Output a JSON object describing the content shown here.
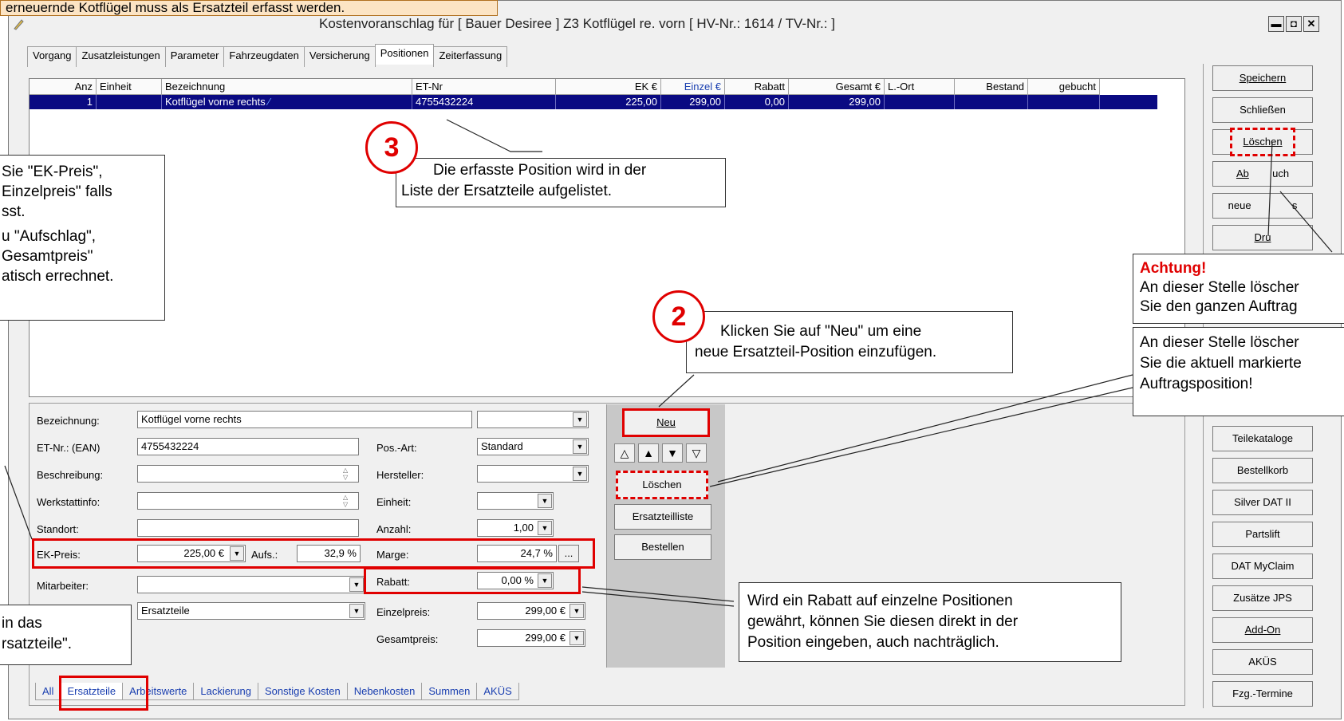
{
  "window": {
    "title": "Kostenvoranschlag  für [ Bauer Desiree ] Z3 Kotflügel re. vorn [ HV-Nr.: 1614 / TV-Nr.: ]",
    "minimize": "▬",
    "maximize": "◘",
    "close": "✕"
  },
  "top_note": "erneuernde Kotflügel muss als Ersatzteil erfasst werden.",
  "tabs": [
    "Vorgang",
    "Zusatzleistungen",
    "Parameter",
    "Fahrzeugdaten",
    "Versicherung",
    "Positionen",
    "Zeiterfassung"
  ],
  "selected_tab": "Positionen",
  "table": {
    "columns": [
      "Anz",
      "Einheit",
      "Bezeichnung",
      "ET-Nr",
      "EK €",
      "Einzel €",
      "Rabatt",
      "Gesamt €",
      "L.-Ort",
      "Bestand",
      "gebucht"
    ],
    "row": {
      "anz": "1",
      "einheit": "",
      "bezeichnung": "Kotflügel vorne rechts",
      "etnr": "4755432224",
      "ek": "225,00",
      "einzel": "299,00",
      "rabatt": "0,00",
      "gesamt": "299,00",
      "lort": "",
      "bestand": "",
      "gebucht": ""
    }
  },
  "form": {
    "bezeichnung_label": "Bezeichnung:",
    "bezeichnung_value": "Kotflügel vorne rechts",
    "etnr_label": "ET-Nr.: (EAN)",
    "etnr_value": "4755432224",
    "beschreibung_label": "Beschreibung:",
    "werkstattinfo_label": "Werkstattinfo:",
    "standort_label": "Standort:",
    "ekpreis_label": "EK-Preis:",
    "ekpreis_value": "225,00 €",
    "aufs_label": "Aufs.:",
    "aufs_value": "32,9 %",
    "mitarbeiter_label": "Mitarbeiter:",
    "kategorie_value": "Ersatzteile",
    "posart_label": "Pos.-Art:",
    "posart_value": "Standard",
    "hersteller_label": "Hersteller:",
    "einheit_label": "Einheit:",
    "anzahl_label": "Anzahl:",
    "anzahl_value": "1,00",
    "marge_label": "Marge:",
    "marge_value": "24,7 %",
    "rabatt_label": "Rabatt:",
    "rabatt_value": "0,00 %",
    "einzelpreis_label": "Einzelpreis:",
    "einzelpreis_value": "299,00 €",
    "gesamtpreis_label": "Gesamtpreis:",
    "gesamtpreis_value": "299,00 €",
    "ellipsis": "..."
  },
  "mid_buttons": {
    "neu": "Neu",
    "loeschen": "Löschen",
    "ersatzteilliste": "Ersatzteilliste",
    "bestellen": "Bestellen"
  },
  "right_buttons": {
    "speichern": "Speichern",
    "schliessen": "Schließen",
    "loeschen": "Löschen",
    "abbruch_a": "Ab",
    "abbruch_b": "uch",
    "neuer_a": "neue",
    "neuer_b": "s",
    "druck": "Dru",
    "teilekataloge": "Teilekataloge",
    "bestellkorb": "Bestellkorb",
    "silverdat": "Silver DAT II",
    "partslift": "Partslift",
    "datmyclaim": "DAT MyClaim",
    "zusaetze": "Zusätze JPS",
    "addon": "Add-On",
    "akues": "AKÜS",
    "fzgtermine": "Fzg.-Termine"
  },
  "bottom_tabs": [
    "All",
    "Ersatzteile",
    "Arbeitswerte",
    "Lackierung",
    "Sonstige Kosten",
    "Nebenkosten",
    "Summen",
    "AKÜS"
  ],
  "callouts": {
    "step3_number": "3",
    "step3_l1": "Die erfasste Position wird in der",
    "step3_l2": "Liste der Ersatzteile aufgelistet.",
    "step2_number": "2",
    "step2_l1": "Klicken Sie auf \"Neu\" um eine",
    "step2_l2": "neue Ersatzteil-Position einzufügen.",
    "left_l1": "Sie \"EK-Preis\",",
    "left_l2": "Einzelpreis\" falls",
    "left_l3": "sst.",
    "left_l4": "u \"Aufschlag\",",
    "left_l5": "Gesamtpreis\"",
    "left_l6": "atisch errechnet.",
    "leftbottom_l1": "in das",
    "leftbottom_l2": "rsatzteile\".",
    "rabatt_l1": "Wird ein Rabatt auf einzelne Positionen",
    "rabatt_l2": "gewährt, können Sie diesen direkt in der",
    "rabatt_l3": "Position eingeben, auch nachträglich.",
    "achtung_title": "Achtung!",
    "achtung_l1": "An dieser Stelle löscher",
    "achtung_l2": "Sie den ganzen Auftrag",
    "pos_l1": "An dieser Stelle löscher",
    "pos_l2": "Sie die aktuell markierte",
    "pos_l3": "Auftragsposition!"
  },
  "colors": {
    "accent_red": "#e00000",
    "selection_blue": "#0a0a82",
    "note_orange": "#fce4c4",
    "tab_link_blue": "#1a3fb0"
  }
}
